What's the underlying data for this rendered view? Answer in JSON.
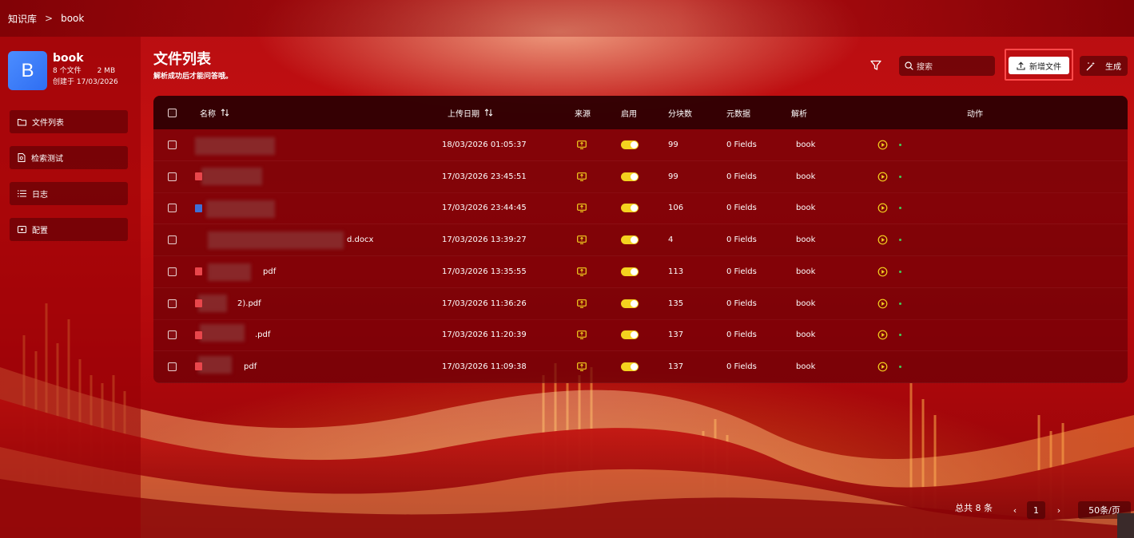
{
  "breadcrumb": {
    "root": "知识库",
    "separator": ">",
    "current": "book"
  },
  "kb": {
    "avatar_letter": "B",
    "name": "book",
    "file_count": "8 个文件",
    "size": "2 MB",
    "created": "创建于 17/03/2026"
  },
  "nav": [
    {
      "label": "文件列表",
      "icon": "folder-icon"
    },
    {
      "label": "检索测试",
      "icon": "document-search-icon"
    },
    {
      "label": "日志",
      "icon": "list-icon"
    },
    {
      "label": "配置",
      "icon": "config-icon"
    }
  ],
  "page": {
    "title": "文件列表",
    "subtitle": "解析成功后才能问答哦。"
  },
  "toolbar": {
    "search_placeholder": "搜索",
    "add_label": "新增文件",
    "generate_label": "生成"
  },
  "table": {
    "columns": {
      "name": "名称",
      "upload_date": "上传日期",
      "source": "来源",
      "enabled": "启用",
      "chunks": "分块数",
      "metadata": "元数据",
      "parser": "解析",
      "actions": "动作"
    },
    "rows": [
      {
        "name": "",
        "type": "blank",
        "date": "18/03/2026 01:05:37",
        "chunks": "99",
        "metadata": "0 Fields",
        "parser": "book"
      },
      {
        "name": "",
        "type": "pdf",
        "date": "17/03/2026 23:45:51",
        "chunks": "99",
        "metadata": "0 Fields",
        "parser": "book"
      },
      {
        "name": "",
        "type": "doc",
        "date": "17/03/2026 23:44:45",
        "chunks": "106",
        "metadata": "0 Fields",
        "parser": "book"
      },
      {
        "name": "d.docx",
        "type": "doc",
        "date": "17/03/2026 13:39:27",
        "chunks": "4",
        "metadata": "0 Fields",
        "parser": "book"
      },
      {
        "name": "pdf",
        "type": "pdf",
        "date": "17/03/2026 13:35:55",
        "chunks": "113",
        "metadata": "0 Fields",
        "parser": "book"
      },
      {
        "name": "2).pdf",
        "type": "pdf",
        "date": "17/03/2026 11:36:26",
        "chunks": "135",
        "metadata": "0 Fields",
        "parser": "book"
      },
      {
        "name": ".pdf",
        "type": "pdf",
        "date": "17/03/2026 11:20:39",
        "chunks": "137",
        "metadata": "0 Fields",
        "parser": "book"
      },
      {
        "name": "pdf",
        "type": "pdf",
        "date": "17/03/2026 11:09:38",
        "chunks": "137",
        "metadata": "0 Fields",
        "parser": "book"
      }
    ]
  },
  "pagination": {
    "total": "总共 8 条",
    "prev": "‹",
    "page": "1",
    "next": "›",
    "page_size": "50条/页"
  },
  "colors": {
    "accent_yellow": "#f4d21f",
    "highlight_border": "#ff4a4a",
    "avatar_blue": "#3b7cf7"
  }
}
